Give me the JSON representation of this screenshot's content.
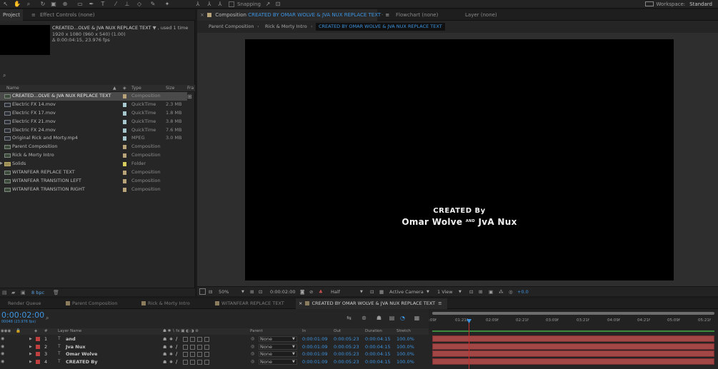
{
  "toolbar": {
    "snapping_label": "Snapping",
    "workspace_label": "Workspace:",
    "workspace_value": "Standard"
  },
  "left_tabs": {
    "project": "Project",
    "effect_controls": "Effect Controls (none)"
  },
  "project": {
    "selected_name": "CREATED...OLVE & JVA NUX REPLACE TEXT",
    "used_count": ", used 1 time",
    "resolution": "1920 x 1080  (960 x 540) (1.00)",
    "duration": "Δ 0:00:04:15, 23.976 fps",
    "columns": {
      "name": "Name",
      "type": "Type",
      "size": "Size",
      "frame": "Fra"
    },
    "items": [
      {
        "name": "CREATED...OLVE & JVA NUX REPLACE TEXT",
        "type": "Composition",
        "size": "",
        "kind": "comp",
        "label_color": "#b8a478"
      },
      {
        "name": "Electric FX 14.mov",
        "type": "QuickTime",
        "size": "2.3 MB",
        "kind": "qt",
        "label_color": "#a8c8d0"
      },
      {
        "name": "Electric FX 17.mov",
        "type": "QuickTime",
        "size": "1.8 MB",
        "kind": "qt",
        "label_color": "#a8c8d0"
      },
      {
        "name": "Electric FX 21.mov",
        "type": "QuickTime",
        "size": "3.8 MB",
        "kind": "qt",
        "label_color": "#a8c8d0"
      },
      {
        "name": "Electric FX 24.mov",
        "type": "QuickTime",
        "size": "7.6 MB",
        "kind": "qt",
        "label_color": "#a8c8d0"
      },
      {
        "name": "Original Rick and Morty.mp4",
        "type": "MPEG",
        "size": "3.0 MB",
        "kind": "qt",
        "label_color": "#a8c8d0"
      },
      {
        "name": "Parent Composition",
        "type": "Composition",
        "size": "",
        "kind": "comp",
        "label_color": "#b8a478"
      },
      {
        "name": "Rick & Morty Intro",
        "type": "Composition",
        "size": "",
        "kind": "comp",
        "label_color": "#b8a478"
      },
      {
        "name": "Solids",
        "type": "Folder",
        "size": "",
        "kind": "folder",
        "label_color": "#d8cc5c"
      },
      {
        "name": "WITANFEAR REPLACE TEXT",
        "type": "Composition",
        "size": "",
        "kind": "comp",
        "label_color": "#b8a478"
      },
      {
        "name": "WITANFEAR TRANSITION LEFT",
        "type": "Composition",
        "size": "",
        "kind": "comp",
        "label_color": "#b8a478"
      },
      {
        "name": "WITANFEAR TRANSITION RIGHT",
        "type": "Composition",
        "size": "",
        "kind": "comp",
        "label_color": "#b8a478"
      }
    ],
    "bpc": "8 bpc"
  },
  "comp_tabs": {
    "composition_prefix": "Composition",
    "composition_name": "CREATED BY OMAR WOLVE & JVA NUX REPLACE TEXT",
    "flowchart": "Flowchart (none)",
    "layer": "Layer (none)"
  },
  "breadcrumbs": [
    "Parent Composition",
    "Rick & Morty Intro",
    "CREATED BY OMAR WOLVE & JVA NUX REPLACE TEXT"
  ],
  "viewer": {
    "credit_line1": "CREATED By",
    "credit_name1": "Omar Wolve",
    "credit_and": "AND",
    "credit_name2": "JvA Nux"
  },
  "viewer_footer": {
    "zoom": "50%",
    "timecode": "0:00:02:00",
    "resolution": "Half",
    "camera": "Active Camera",
    "views": "1 View",
    "exposure": "+0.0"
  },
  "timeline_tabs": [
    "Render Queue",
    "Parent Composition",
    "Rick & Morty Intro",
    "WITANFEAR REPLACE TEXT",
    "CREATED BY OMAR WOLVE & JVA NUX REPLACE TEXT"
  ],
  "timeline": {
    "timecode": "0:00:02:00",
    "fps": "00048 (23.976 fps)",
    "ruler_labels": [
      ":09f",
      "01:21f",
      "02:09f",
      "02:21f",
      "03:09f",
      "03:21f",
      "04:09f",
      "04:21f",
      "05:09f",
      "05:21f"
    ],
    "columns": {
      "number": "#",
      "layer_name": "Layer Name",
      "parent": "Parent",
      "in": "In",
      "out": "Out",
      "duration": "Duration",
      "stretch": "Stretch"
    },
    "layers": [
      {
        "num": "1",
        "name": "and",
        "parent": "None",
        "in": "0:00:01:09",
        "out": "0:00:05:23",
        "duration": "0:00:04:15",
        "stretch": "100.0%"
      },
      {
        "num": "2",
        "name": "Jva Nux",
        "parent": "None",
        "in": "0:00:01:09",
        "out": "0:00:05:23",
        "duration": "0:00:04:15",
        "stretch": "100.0%"
      },
      {
        "num": "3",
        "name": "Omar Wolve",
        "parent": "None",
        "in": "0:00:01:09",
        "out": "0:00:05:23",
        "duration": "0:00:04:15",
        "stretch": "100.0%"
      },
      {
        "num": "4",
        "name": "CREATED By",
        "parent": "None",
        "in": "0:00:01:09",
        "out": "0:00:05:23",
        "duration": "0:00:04:15",
        "stretch": "100.0%"
      }
    ]
  }
}
